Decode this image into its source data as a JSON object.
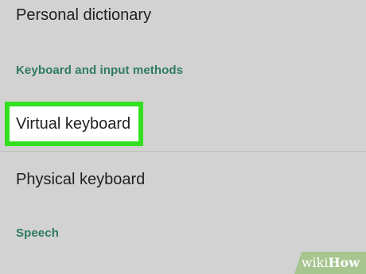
{
  "settings_list": {
    "personal_dictionary_label": "Personal dictionary",
    "section_keyboard_label": "Keyboard and input methods",
    "virtual_keyboard_label": "Virtual keyboard",
    "physical_keyboard_label": "Physical keyboard",
    "section_speech_label": "Speech"
  },
  "watermark": {
    "wiki": "wiki",
    "how": "How"
  },
  "colors": {
    "background": "#d2d2d2",
    "section_header": "#2f7a62",
    "highlight_border": "#33e01f",
    "watermark_bg": "#a7c58f"
  }
}
